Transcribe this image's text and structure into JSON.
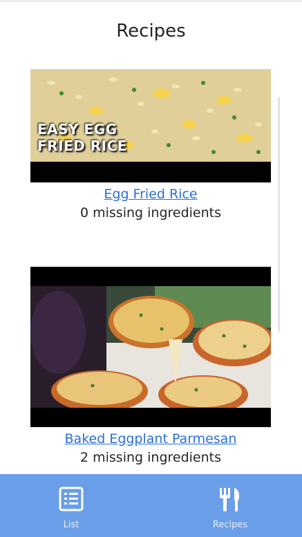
{
  "header": {
    "title": "Recipes"
  },
  "recipes": [
    {
      "name": "Egg Fried Rice",
      "missing": "0 missing ingredients",
      "thumbnail_text_line1": "EASY EGG",
      "thumbnail_text_line2": "FRIED RICE"
    },
    {
      "name": "Baked Eggplant Parmesan",
      "missing": "2 missing ingredients"
    }
  ],
  "tabs": [
    {
      "label": "List",
      "icon": "list-icon"
    },
    {
      "label": "Recipes",
      "icon": "fork-knife-icon"
    }
  ],
  "colors": {
    "tabbar": "#6a9ee8",
    "link": "#2b6fd6"
  }
}
